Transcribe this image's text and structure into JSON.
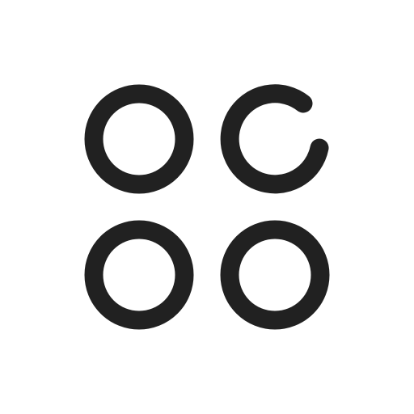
{
  "icon": {
    "name": "apps-add-in-icon",
    "color": "#212121",
    "background": "#ffffff",
    "parts": [
      {
        "name": "circle-top-left",
        "shape": "full-circle"
      },
      {
        "name": "circle-top-right-open",
        "shape": "open-circle"
      },
      {
        "name": "circle-bottom-left",
        "shape": "full-circle"
      },
      {
        "name": "circle-bottom-right",
        "shape": "full-circle"
      }
    ]
  }
}
